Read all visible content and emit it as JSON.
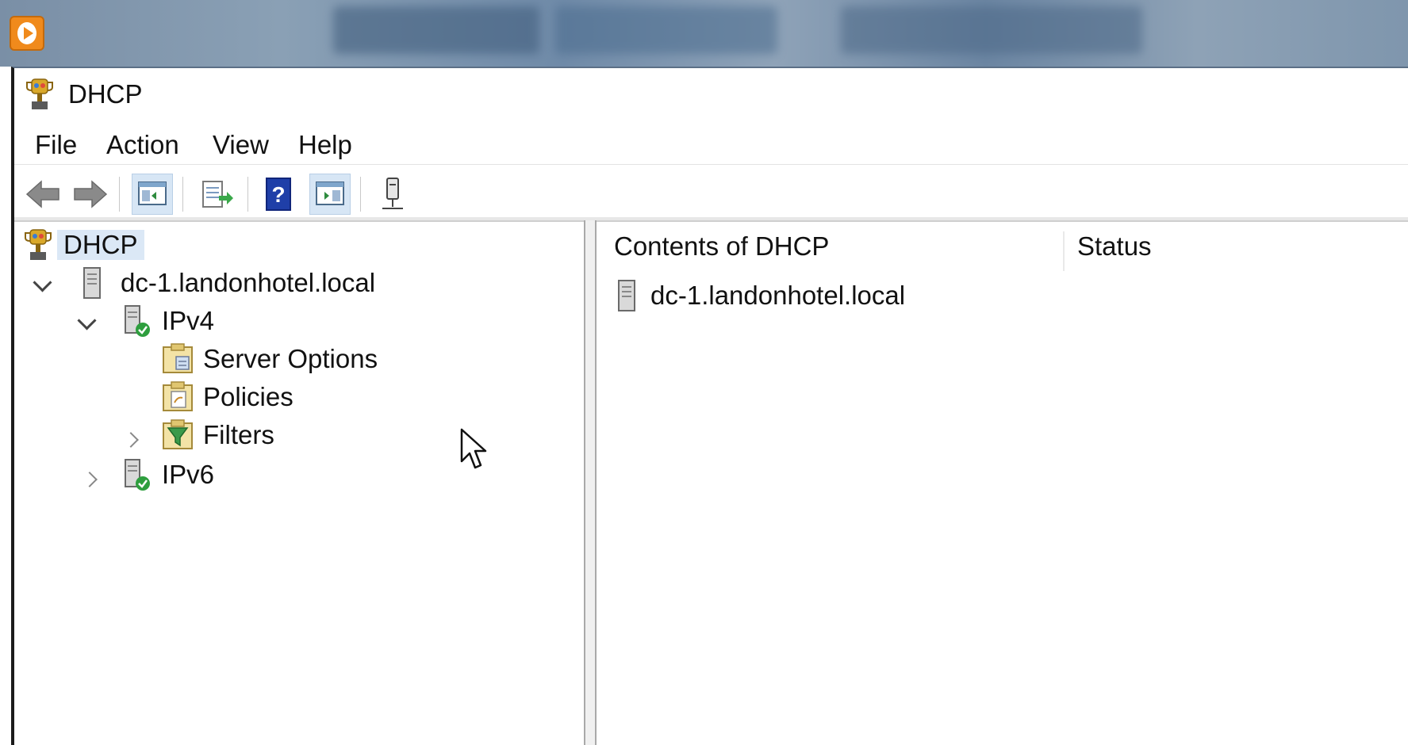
{
  "window": {
    "title": "DHCP"
  },
  "menu": {
    "items": [
      "File",
      "Action",
      "View",
      "Help"
    ]
  },
  "toolbar": {
    "buttons": [
      {
        "icon": "back-arrow-icon",
        "pressed": false
      },
      {
        "icon": "forward-arrow-icon",
        "pressed": false
      },
      {
        "icon": "show-hide-console-tree-icon",
        "pressed": true
      },
      {
        "icon": "export-list-icon",
        "pressed": false
      },
      {
        "icon": "help-icon",
        "pressed": false
      },
      {
        "icon": "show-hide-action-pane-icon",
        "pressed": true
      },
      {
        "icon": "server-connect-icon",
        "pressed": false
      }
    ]
  },
  "tree": {
    "root": "DHCP",
    "server": "dc-1.landonhotel.local",
    "ipv4": "IPv4",
    "server_options": "Server Options",
    "policies": "Policies",
    "filters": "Filters",
    "ipv6": "IPv6"
  },
  "list": {
    "columns": [
      "Contents of DHCP",
      "Status"
    ],
    "rows": [
      {
        "name": "dc-1.landonhotel.local",
        "status": ""
      }
    ]
  },
  "colors": {
    "selection": "#dbe8f6",
    "pressed_button": "#d7e6f5",
    "help_blue": "#1f3fa8",
    "check_green": "#2e9e3e"
  }
}
